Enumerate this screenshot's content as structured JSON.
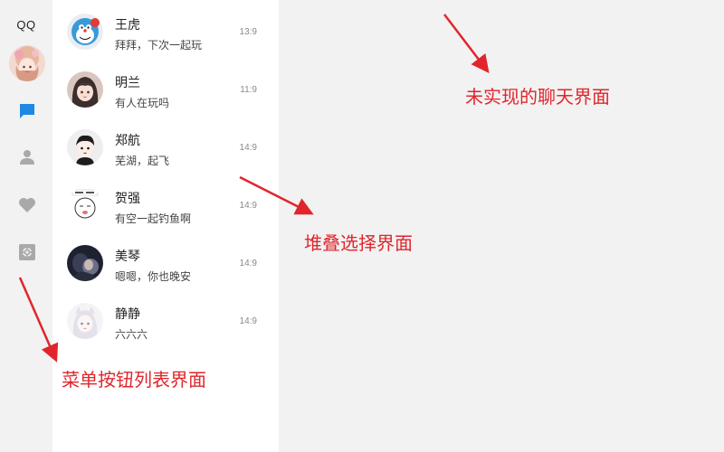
{
  "app": {
    "title": "QQ"
  },
  "menu": {
    "items": [
      {
        "icon": "chat-bubble-icon",
        "active": true
      },
      {
        "icon": "person-icon",
        "active": false
      },
      {
        "icon": "heart-icon",
        "active": false
      },
      {
        "icon": "gear-icon",
        "active": false
      }
    ],
    "colors": {
      "active": "#1e88e5",
      "inactive": "#a9a9a9"
    }
  },
  "conversations": [
    {
      "name": "王虎",
      "message": "拜拜，下次一起玩",
      "time": "13:9"
    },
    {
      "name": "明兰",
      "message": "有人在玩吗",
      "time": "11:9"
    },
    {
      "name": "郑航",
      "message": "芜湖，起飞",
      "time": "14:9"
    },
    {
      "name": "贺强",
      "message": "有空一起钓鱼啊",
      "time": "14:9"
    },
    {
      "name": "美琴",
      "message": "嗯嗯，你也晚安",
      "time": "14:9"
    },
    {
      "name": "静静",
      "message": "六六六",
      "time": "14:9"
    }
  ],
  "annotations": {
    "chat_area": "未实现的聊天界面",
    "stack_select": "堆叠选择界面",
    "menu_list": "菜单按钮列表界面",
    "color": "#e0262c"
  }
}
